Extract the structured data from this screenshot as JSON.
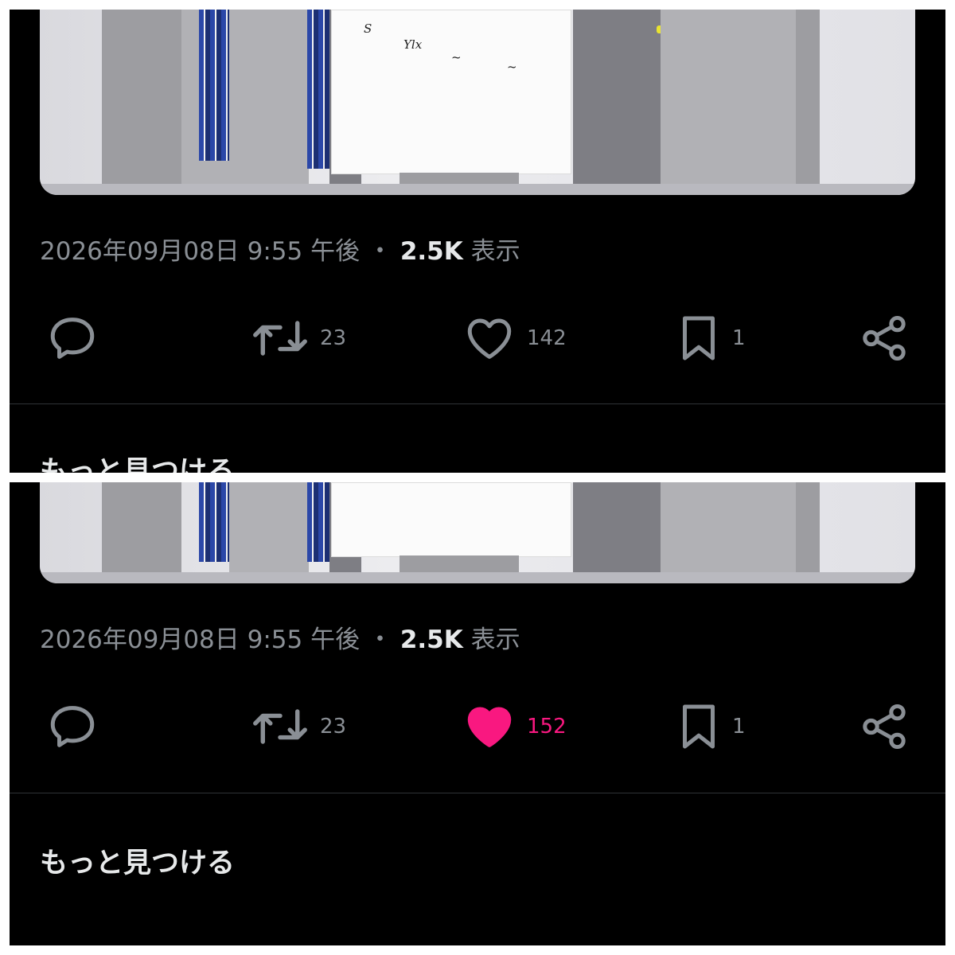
{
  "panels": [
    {
      "timestamp": "2026年09月08日 9:55 午後",
      "views_count": "2.5K",
      "views_label": "表示",
      "retweets": "23",
      "likes": "142",
      "liked": false,
      "bookmarks": "1",
      "discover_heading": "もっと見つける"
    },
    {
      "timestamp": "2026年09月08日 9:55 午後",
      "views_count": "2.5K",
      "views_label": "表示",
      "retweets": "23",
      "likes": "152",
      "liked": true,
      "bookmarks": "1",
      "discover_heading": "もっと見つける"
    }
  ],
  "separator": "・",
  "colors": {
    "background": "#000000",
    "muted_text": "#8a8f95",
    "primary_text": "#e7e9ea",
    "like_active": "#f91880",
    "frame": "#ffffff"
  },
  "icons": [
    "reply-icon",
    "retweet-icon",
    "heart-icon",
    "bookmark-icon",
    "share-icon"
  ]
}
